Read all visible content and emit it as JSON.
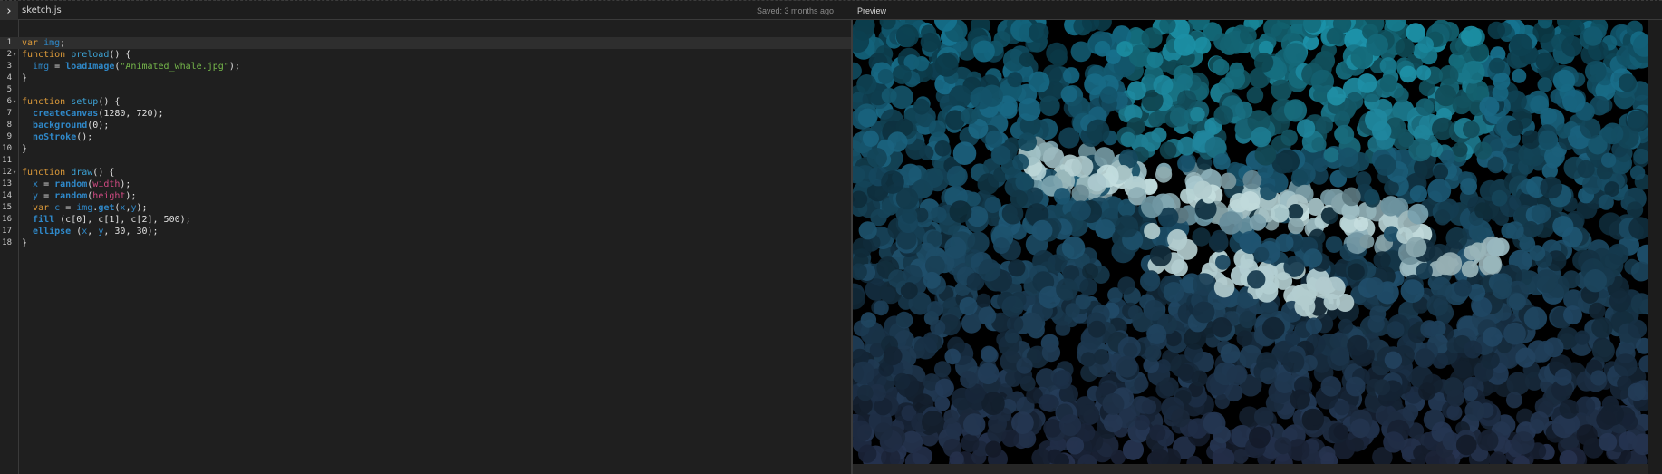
{
  "toolbar": {
    "toggle_glyph": "›",
    "file_tab": "sketch.js",
    "saved_status": "Saved: 3 months ago",
    "preview_label": "Preview"
  },
  "editor": {
    "lines": [
      {
        "n": "1",
        "fold": "",
        "tokens": [
          [
            "kw",
            "var"
          ],
          [
            "punc",
            " "
          ],
          [
            "vr",
            "img"
          ],
          [
            "punc",
            ";"
          ]
        ]
      },
      {
        "n": "2",
        "fold": "▾",
        "tokens": [
          [
            "kw",
            "function"
          ],
          [
            "punc",
            " "
          ],
          [
            "fn",
            "preload"
          ],
          [
            "punc",
            "() {"
          ]
        ]
      },
      {
        "n": "3",
        "fold": "",
        "tokens": [
          [
            "punc",
            "  "
          ],
          [
            "vr",
            "img"
          ],
          [
            "punc",
            " = "
          ],
          [
            "fnb",
            "loadImage"
          ],
          [
            "punc",
            "("
          ],
          [
            "str",
            "\"Animated_whale.jpg\""
          ],
          [
            "punc",
            ");"
          ]
        ]
      },
      {
        "n": "4",
        "fold": "",
        "tokens": [
          [
            "punc",
            "}"
          ]
        ]
      },
      {
        "n": "5",
        "fold": "",
        "tokens": []
      },
      {
        "n": "6",
        "fold": "▾",
        "tokens": [
          [
            "kw",
            "function"
          ],
          [
            "punc",
            " "
          ],
          [
            "fn",
            "setup"
          ],
          [
            "punc",
            "() {"
          ]
        ]
      },
      {
        "n": "7",
        "fold": "",
        "tokens": [
          [
            "punc",
            "  "
          ],
          [
            "fnb",
            "createCanvas"
          ],
          [
            "punc",
            "(1280, 720);"
          ]
        ]
      },
      {
        "n": "8",
        "fold": "",
        "tokens": [
          [
            "punc",
            "  "
          ],
          [
            "fnb",
            "background"
          ],
          [
            "punc",
            "(0);"
          ]
        ]
      },
      {
        "n": "9",
        "fold": "",
        "tokens": [
          [
            "punc",
            "  "
          ],
          [
            "fnb",
            "noStroke"
          ],
          [
            "punc",
            "();"
          ]
        ]
      },
      {
        "n": "10",
        "fold": "",
        "tokens": [
          [
            "punc",
            "}"
          ]
        ]
      },
      {
        "n": "11",
        "fold": "",
        "tokens": []
      },
      {
        "n": "12",
        "fold": "▾",
        "tokens": [
          [
            "kw",
            "function"
          ],
          [
            "punc",
            " "
          ],
          [
            "fn",
            "draw"
          ],
          [
            "punc",
            "() {"
          ]
        ]
      },
      {
        "n": "13",
        "fold": "",
        "tokens": [
          [
            "punc",
            "  "
          ],
          [
            "vr",
            "x"
          ],
          [
            "punc",
            " = "
          ],
          [
            "fnb",
            "random"
          ],
          [
            "punc",
            "("
          ],
          [
            "builtin",
            "width"
          ],
          [
            "punc",
            ");"
          ]
        ]
      },
      {
        "n": "14",
        "fold": "",
        "tokens": [
          [
            "punc",
            "  "
          ],
          [
            "vr",
            "y"
          ],
          [
            "punc",
            " = "
          ],
          [
            "fnb",
            "random"
          ],
          [
            "punc",
            "("
          ],
          [
            "builtin",
            "height"
          ],
          [
            "punc",
            ");"
          ]
        ]
      },
      {
        "n": "15",
        "fold": "",
        "tokens": [
          [
            "punc",
            "  "
          ],
          [
            "kw",
            "var"
          ],
          [
            "punc",
            " "
          ],
          [
            "vr",
            "c"
          ],
          [
            "punc",
            " = "
          ],
          [
            "vr",
            "img"
          ],
          [
            "punc",
            "."
          ],
          [
            "fnb",
            "get"
          ],
          [
            "punc",
            "("
          ],
          [
            "vr",
            "x"
          ],
          [
            "punc",
            ","
          ],
          [
            "vr",
            "y"
          ],
          [
            "punc",
            ");"
          ]
        ]
      },
      {
        "n": "16",
        "fold": "",
        "tokens": [
          [
            "punc",
            "  "
          ],
          [
            "fnb",
            "fill"
          ],
          [
            "punc",
            " (c[0], c[1], c[2], 500);"
          ]
        ]
      },
      {
        "n": "17",
        "fold": "",
        "tokens": [
          [
            "punc",
            "  "
          ],
          [
            "fnb",
            "ellipse"
          ],
          [
            "punc",
            " ("
          ],
          [
            "vr",
            "x"
          ],
          [
            "punc",
            ", "
          ],
          [
            "vr",
            "y"
          ],
          [
            "punc",
            ", 30, 30);"
          ]
        ]
      },
      {
        "n": "18",
        "fold": "",
        "tokens": [
          [
            "punc",
            "}"
          ]
        ]
      }
    ]
  },
  "colors": {
    "keyword": "#dc9a3a",
    "function_name": "#3da3d6",
    "string": "#76b84b",
    "builtin": "#d04a83"
  }
}
